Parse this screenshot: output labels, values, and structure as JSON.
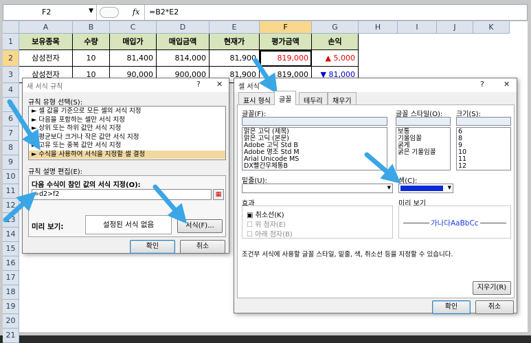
{
  "formula_bar": {
    "name_box": "F2",
    "fx": "fx",
    "formula": "=B2*E2"
  },
  "columns": [
    "A",
    "B",
    "C",
    "D",
    "E",
    "F",
    "G",
    "H",
    "I",
    "J",
    "K"
  ],
  "rows": [
    "1",
    "2",
    "3",
    "4",
    "5",
    "6",
    "7",
    "8",
    "9",
    "10",
    "11",
    "12",
    "13",
    "14",
    "15",
    "16",
    "17",
    "18",
    "19",
    "20",
    "21"
  ],
  "table": {
    "headers": [
      "보유종목",
      "수량",
      "매입가",
      "매입금액",
      "현재가",
      "평가금액",
      "손익"
    ],
    "rows": [
      [
        "삼성전자",
        "10",
        "81,400",
        "814,000",
        "81,900",
        "819,000",
        "▲ 5,000"
      ],
      [
        "삼성전자",
        "10",
        "90,000",
        "900,000",
        "81,900",
        "819,000",
        "▼ 81,000"
      ]
    ]
  },
  "rule_dialog": {
    "title": "새 서식 규칙",
    "help": "?",
    "close": "✕",
    "rule_type_label": "규칙 유형 선택(S):",
    "rule_types": [
      "► 셀 값을 기준으로 모든 셀의 서식 지정",
      "► 다음을 포함하는 셀만 서식 지정",
      "► 상위 또는 하위 값만 서식 지정",
      "► 평균보다 크거나 작은 값만 서식 지정",
      "► 고유 또는 중복 값만 서식 지정",
      "► 수식을 사용하여 서식을 지정할 셀 결정"
    ],
    "edit_label": "규칙 설명 편집(E):",
    "formula_label": "다음 수식이 참인 값의 서식 지정(O):",
    "formula_value": "=d2>f2",
    "preview_label": "미리 보기:",
    "preview_text": "설정된 서식 없음",
    "format_button": "서식(F)...",
    "ok": "확인",
    "cancel": "취소"
  },
  "format_dialog": {
    "title": "셀 서식",
    "help": "?",
    "close": "✕",
    "tabs": [
      "표시 형식",
      "글꼴",
      "테두리",
      "채우기"
    ],
    "font_label": "글꼴(F):",
    "fonts": [
      "맑은 고딕 (제목)",
      "맑은 고딕 (본문)",
      "Adobe 고딕 Std B",
      "Adobe 명조 Std M",
      "Arial Unicode MS",
      "DX빨간우체통B"
    ],
    "style_label": "글꼴 스타일(O):",
    "styles": [
      "보통",
      "기울임꼴",
      "굵게",
      "굵은 기울임꼴"
    ],
    "size_label": "크기(S):",
    "sizes": [
      "6",
      "8",
      "9",
      "10",
      "11",
      "12"
    ],
    "underline_label": "밑줄(U):",
    "color_label": "색(C):",
    "effects_label": "효과",
    "strike": "취소선(K)",
    "superscript": "위 첨자(E)",
    "subscript": "아래 첨자(B)",
    "preview_label": "미리 보기",
    "preview_sample": "가나다AaBbCc",
    "description": "조건부 서식에 사용할 글꼴 스타일, 밑줄, 색, 취소선 등을 지정할 수 있습니다.",
    "clear_button": "지우기(R)",
    "ok": "확인",
    "cancel": "취소"
  },
  "colors": {
    "header_fill": "#d7e4bc",
    "selected": "#f9d78d",
    "accent_arrow": "#3aa6e6",
    "up": "#e00000",
    "down": "#0000d0"
  }
}
